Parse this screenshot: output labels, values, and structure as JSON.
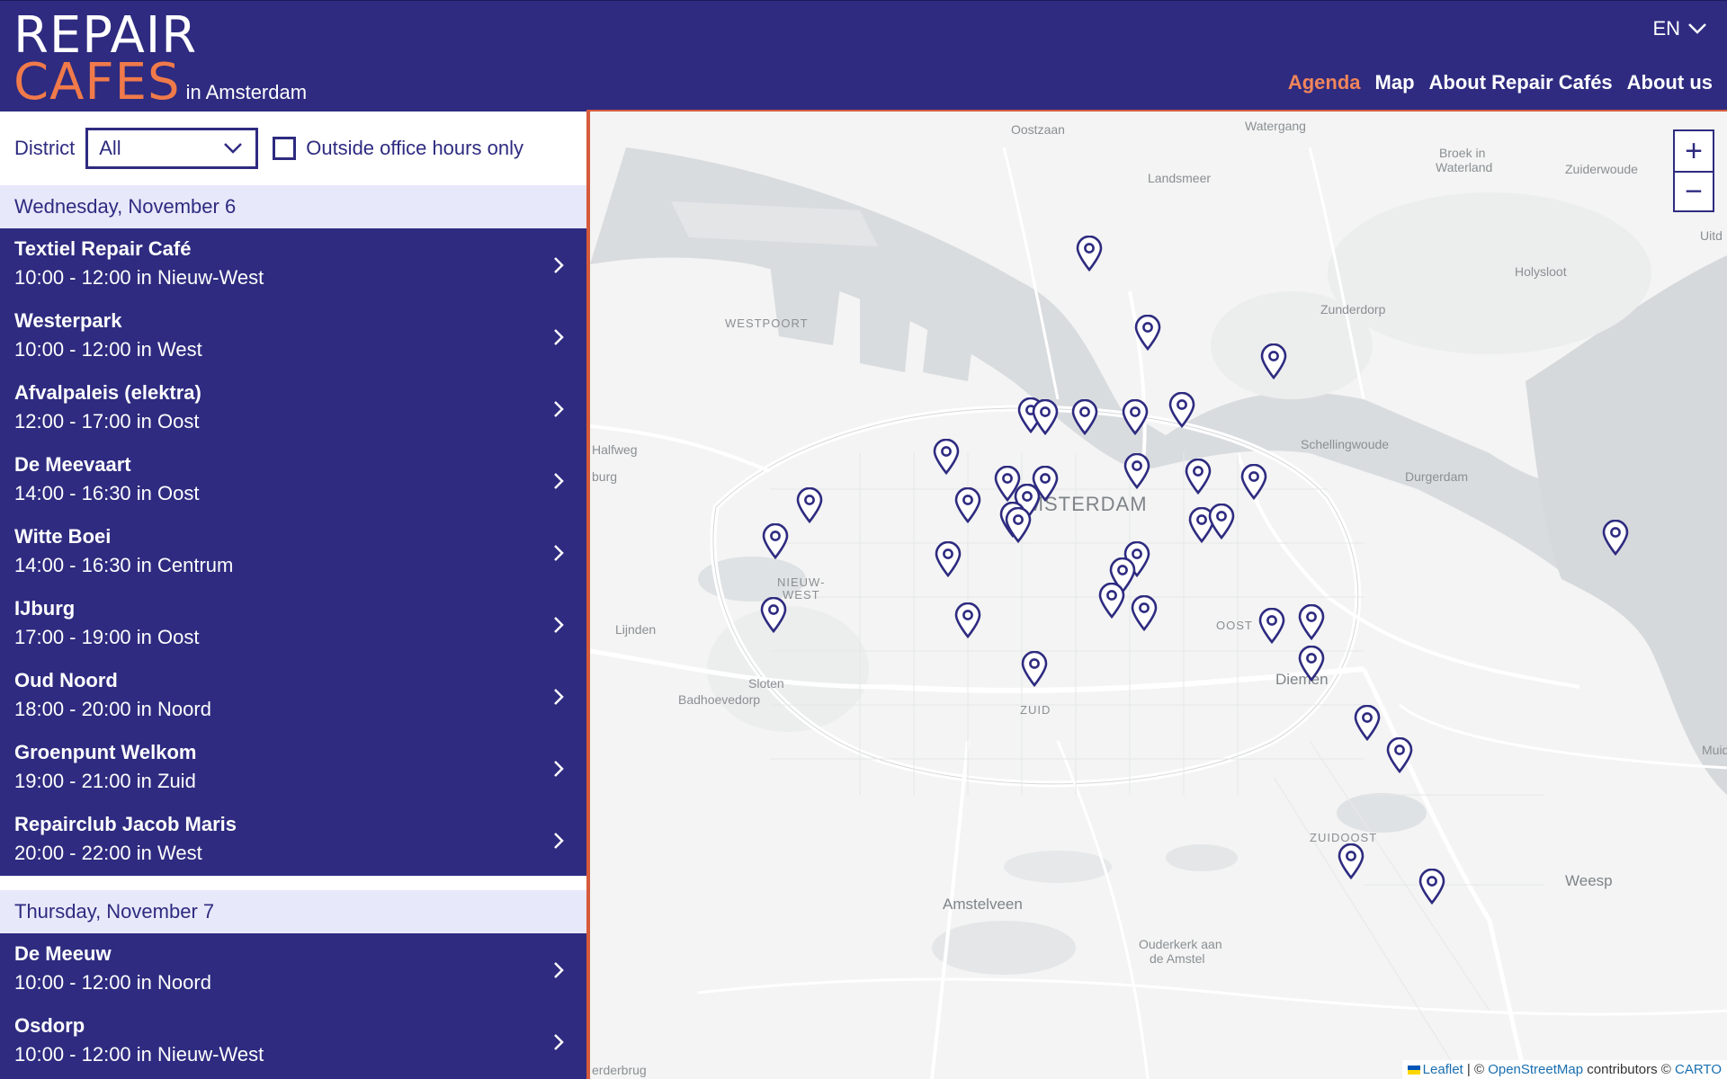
{
  "header": {
    "logo_line1": "REPAIR",
    "logo_line2": "CAFES",
    "logo_city": "in Amsterdam",
    "language": "EN",
    "nav": [
      {
        "label": "Agenda",
        "active": true
      },
      {
        "label": "Map",
        "active": false
      },
      {
        "label": "About Repair Cafés",
        "active": false
      },
      {
        "label": "About us",
        "active": false
      }
    ]
  },
  "filters": {
    "district_label": "District",
    "district_value": "All",
    "office_hours_label": "Outside office hours only",
    "office_hours_checked": false
  },
  "agenda": [
    {
      "day": "Wednesday, November 6",
      "events": [
        {
          "name": "Textiel Repair Café",
          "time": "10:00 - 12:00 in Nieuw-West"
        },
        {
          "name": "Westerpark",
          "time": "10:00 - 12:00 in West"
        },
        {
          "name": "Afvalpaleis (elektra)",
          "time": "12:00 - 17:00 in Oost"
        },
        {
          "name": "De Meevaart",
          "time": "14:00 - 16:30 in Oost"
        },
        {
          "name": "Witte Boei",
          "time": "14:00 - 16:30 in Centrum"
        },
        {
          "name": "IJburg",
          "time": "17:00 - 19:00 in Oost"
        },
        {
          "name": "Oud Noord",
          "time": "18:00 - 20:00 in Noord"
        },
        {
          "name": "Groenpunt Welkom",
          "time": "19:00 - 21:00 in Zuid"
        },
        {
          "name": "Repairclub Jacob Maris",
          "time": "20:00 - 22:00 in West"
        }
      ]
    },
    {
      "day": "Thursday, November 7",
      "events": [
        {
          "name": "De Meeuw",
          "time": "10:00 - 12:00 in Noord"
        },
        {
          "name": "Osdorp",
          "time": "10:00 - 12:00 in Nieuw-West"
        }
      ]
    }
  ],
  "map": {
    "places": {
      "oostzaan": "Oostzaan",
      "watergang": "Watergang",
      "landsmeer": "Landsmeer",
      "broek1": "Broek in",
      "broek2": "Waterland",
      "zuiderwoude": "Zuiderwoude",
      "uitd": "Uitd",
      "holysloot": "Holysloot",
      "zunderdorp": "Zunderdorp",
      "westpoort": "WESTPOORT",
      "halfweg": "Halfweg",
      "burg": "burg",
      "schellingwoude": "Schellingwoude",
      "durgerdam": "Durgerdam",
      "amsterdam": "AMSTERDAM",
      "nieuw1": "NIEUW-",
      "nieuw2": "WEST",
      "lijnden": "Lijnden",
      "oost": "OOST",
      "sloten": "Sloten",
      "badhoevedorp": "Badhoevedorp",
      "diemen": "Diemen",
      "zuid": "ZUID",
      "muide": "Muide",
      "zuidoost": "ZUIDOOST",
      "weesp": "Weesp",
      "amstelveen": "Amstelveen",
      "ouderkerk1": "Ouderkerk aan",
      "ouderkerk2": "de Amstel",
      "erderbrug": "erderbrug"
    },
    "zoom_in": "+",
    "zoom_out": "−",
    "attribution": {
      "leaflet": "Leaflet",
      "sep": "| ©",
      "osm": "OpenStreetMap",
      "contrib": "contributors ©",
      "carto": "CARTO"
    },
    "marker_color": "#2e2b80"
  },
  "colors": {
    "brand": "#2e2b80",
    "accent": "#f07a4a",
    "day_header_bg": "#e8e8fb",
    "map_border": "#d65a3c"
  }
}
